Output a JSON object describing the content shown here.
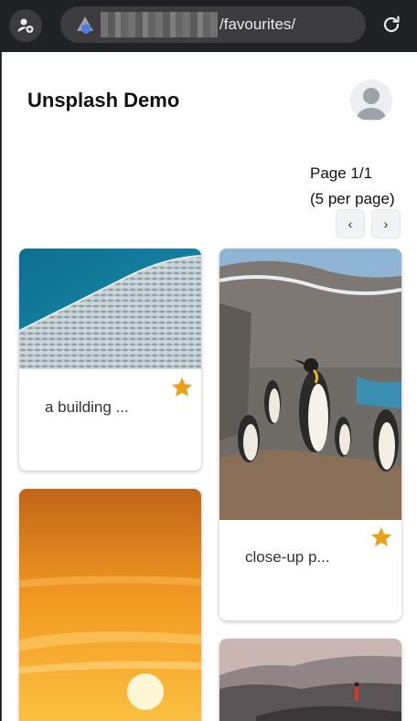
{
  "browser": {
    "url_path": "/favourites/",
    "icons": {
      "profile": "person-add-icon",
      "site": "site-info-icon",
      "reload": "reload-icon"
    }
  },
  "app": {
    "title": "Unsplash Demo",
    "avatar_icon": "user-avatar-icon"
  },
  "pagination": {
    "page_label": "Page 1/1",
    "per_page_label": "(5 per page)",
    "prev_label": "‹",
    "next_label": "›"
  },
  "cards": [
    {
      "caption": "a building ...",
      "favourite": true,
      "image": "building-facade"
    },
    {
      "caption": "close-up p...",
      "favourite": true,
      "image": "penguins"
    },
    {
      "caption": "",
      "favourite": false,
      "image": "sunset"
    },
    {
      "caption": "",
      "favourite": false,
      "image": "mountains"
    }
  ],
  "colors": {
    "star": "#e8a21a",
    "browser_bg": "#202124",
    "title": "#111111"
  }
}
